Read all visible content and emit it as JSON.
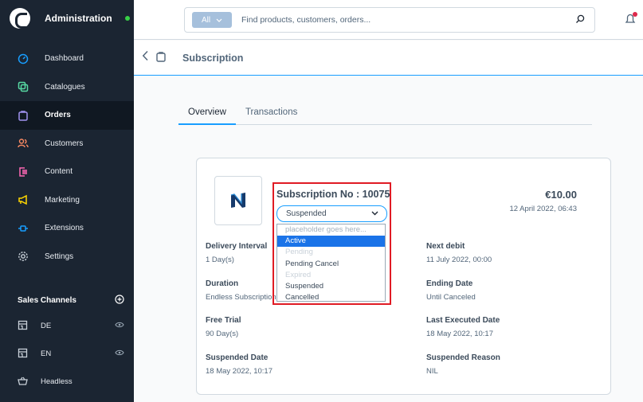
{
  "sidebar": {
    "app_title": "Administration",
    "items": [
      {
        "label": "Dashboard",
        "icon": "gauge-icon",
        "color": "#189eff"
      },
      {
        "label": "Catalogues",
        "icon": "catalogue-icon",
        "color": "#57d9a3"
      },
      {
        "label": "Orders",
        "icon": "bag-icon",
        "color": "#a092f0"
      },
      {
        "label": "Customers",
        "icon": "users-icon",
        "color": "#f88962"
      },
      {
        "label": "Content",
        "icon": "content-icon",
        "color": "#ff68b4"
      },
      {
        "label": "Marketing",
        "icon": "megaphone-icon",
        "color": "#ffd700"
      },
      {
        "label": "Extensions",
        "icon": "plug-icon",
        "color": "#189eff"
      },
      {
        "label": "Settings",
        "icon": "gear-icon",
        "color": "#9aa8b5"
      }
    ],
    "sales_channels_title": "Sales Channels",
    "sales_channels": [
      {
        "label": "DE",
        "icon": "storefront-icon"
      },
      {
        "label": "EN",
        "icon": "storefront-icon"
      },
      {
        "label": "Headless",
        "icon": "basket-icon"
      }
    ]
  },
  "search": {
    "type_label": "All",
    "placeholder": "Find products, customers, orders..."
  },
  "page": {
    "title": "Subscription"
  },
  "tabs": [
    {
      "label": "Overview"
    },
    {
      "label": "Transactions"
    }
  ],
  "subscription": {
    "title": "Subscription No : 10075",
    "status_value": "Suspended",
    "price": "€10.00",
    "created": "12 April 2022, 06:43"
  },
  "fields": {
    "delivery_interval": {
      "label": "Delivery Interval",
      "value": "1 Day(s)"
    },
    "next_debit": {
      "label": "Next debit",
      "value": "11 July 2022, 00:00"
    },
    "duration": {
      "label": "Duration",
      "value": "Endless Subscription"
    },
    "ending_date": {
      "label": "Ending Date",
      "value": "Until Canceled"
    },
    "free_trial": {
      "label": "Free Trial",
      "value": "90 Day(s)"
    },
    "last_executed": {
      "label": "Last Executed Date",
      "value": "18 May 2022, 10:17"
    },
    "suspended_date": {
      "label": "Suspended Date",
      "value": "18 May 2022, 10:17"
    },
    "suspended_reason": {
      "label": "Suspended Reason",
      "value": "NIL"
    }
  },
  "dropdown": {
    "options": [
      {
        "label": "placeholder goes here...",
        "state": "placeholder"
      },
      {
        "label": "Active",
        "state": "highlight"
      },
      {
        "label": "Pending",
        "state": "disabled"
      },
      {
        "label": "Pending Cancel",
        "state": "normal"
      },
      {
        "label": "Expired",
        "state": "disabled"
      },
      {
        "label": "Suspended",
        "state": "normal"
      },
      {
        "label": "Cancelled",
        "state": "normal"
      }
    ]
  },
  "colors": {
    "accent": "#189eff",
    "highlight_box": "#e01b24",
    "sidebar_bg": "#1b2532"
  }
}
